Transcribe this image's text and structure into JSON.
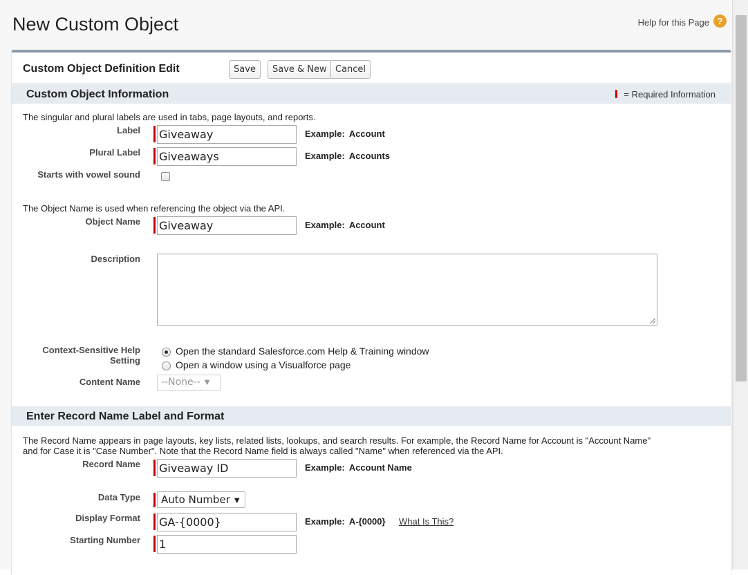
{
  "page": {
    "title": "New Custom Object",
    "help_link": "Help for this Page",
    "help_icon": "question-icon"
  },
  "panel": {
    "title": "Custom Object Definition Edit",
    "buttons": {
      "save": "Save",
      "save_new": "Save & New",
      "cancel": "Cancel"
    }
  },
  "section1": {
    "title": "Custom Object Information",
    "required_legend": "= Required Information",
    "hint_labels": "The singular and plural labels are used in tabs, page layouts, and reports.",
    "label_field": {
      "label": "Label",
      "value": "Giveaway",
      "example_label": "Example:",
      "example_value": "Account"
    },
    "plural_field": {
      "label": "Plural Label",
      "value": "Giveaways",
      "example_label": "Example:",
      "example_value": "Accounts"
    },
    "vowel_field": {
      "label": "Starts with vowel sound",
      "checked": false
    },
    "hint_object": "The Object Name is used when referencing the object via the API.",
    "object_name": {
      "label": "Object Name",
      "value": "Giveaway",
      "example_label": "Example:",
      "example_value": "Account"
    },
    "description": {
      "label": "Description",
      "value": ""
    },
    "help_setting": {
      "label_line1": "Context-Sensitive Help",
      "label_line2": "Setting",
      "option1": "Open the standard Salesforce.com Help & Training window",
      "option2": "Open a window using a Visualforce page",
      "selected": 1
    },
    "content_name": {
      "label": "Content Name",
      "value": "--None--"
    }
  },
  "section2": {
    "title": "Enter Record Name Label and Format",
    "hint_line1": "The Record Name appears in page layouts, key lists, related lists, lookups, and search results. For example, the Record Name for Account is \"Account Name\"",
    "hint_line2": "and for Case it is \"Case Number\". Note that the Record Name field is always called \"Name\" when referenced via the API.",
    "record_name": {
      "label": "Record Name",
      "value": "Giveaway ID",
      "example_label": "Example:",
      "example_value": "Account Name"
    },
    "data_type": {
      "label": "Data Type",
      "value": "Auto Number"
    },
    "display_format": {
      "label": "Display Format",
      "value": "GA-{0000}",
      "example_label": "Example:",
      "example_value": "A-{0000}",
      "what_link": "What Is This?"
    },
    "starting_number": {
      "label": "Starting Number",
      "value": "1"
    }
  }
}
